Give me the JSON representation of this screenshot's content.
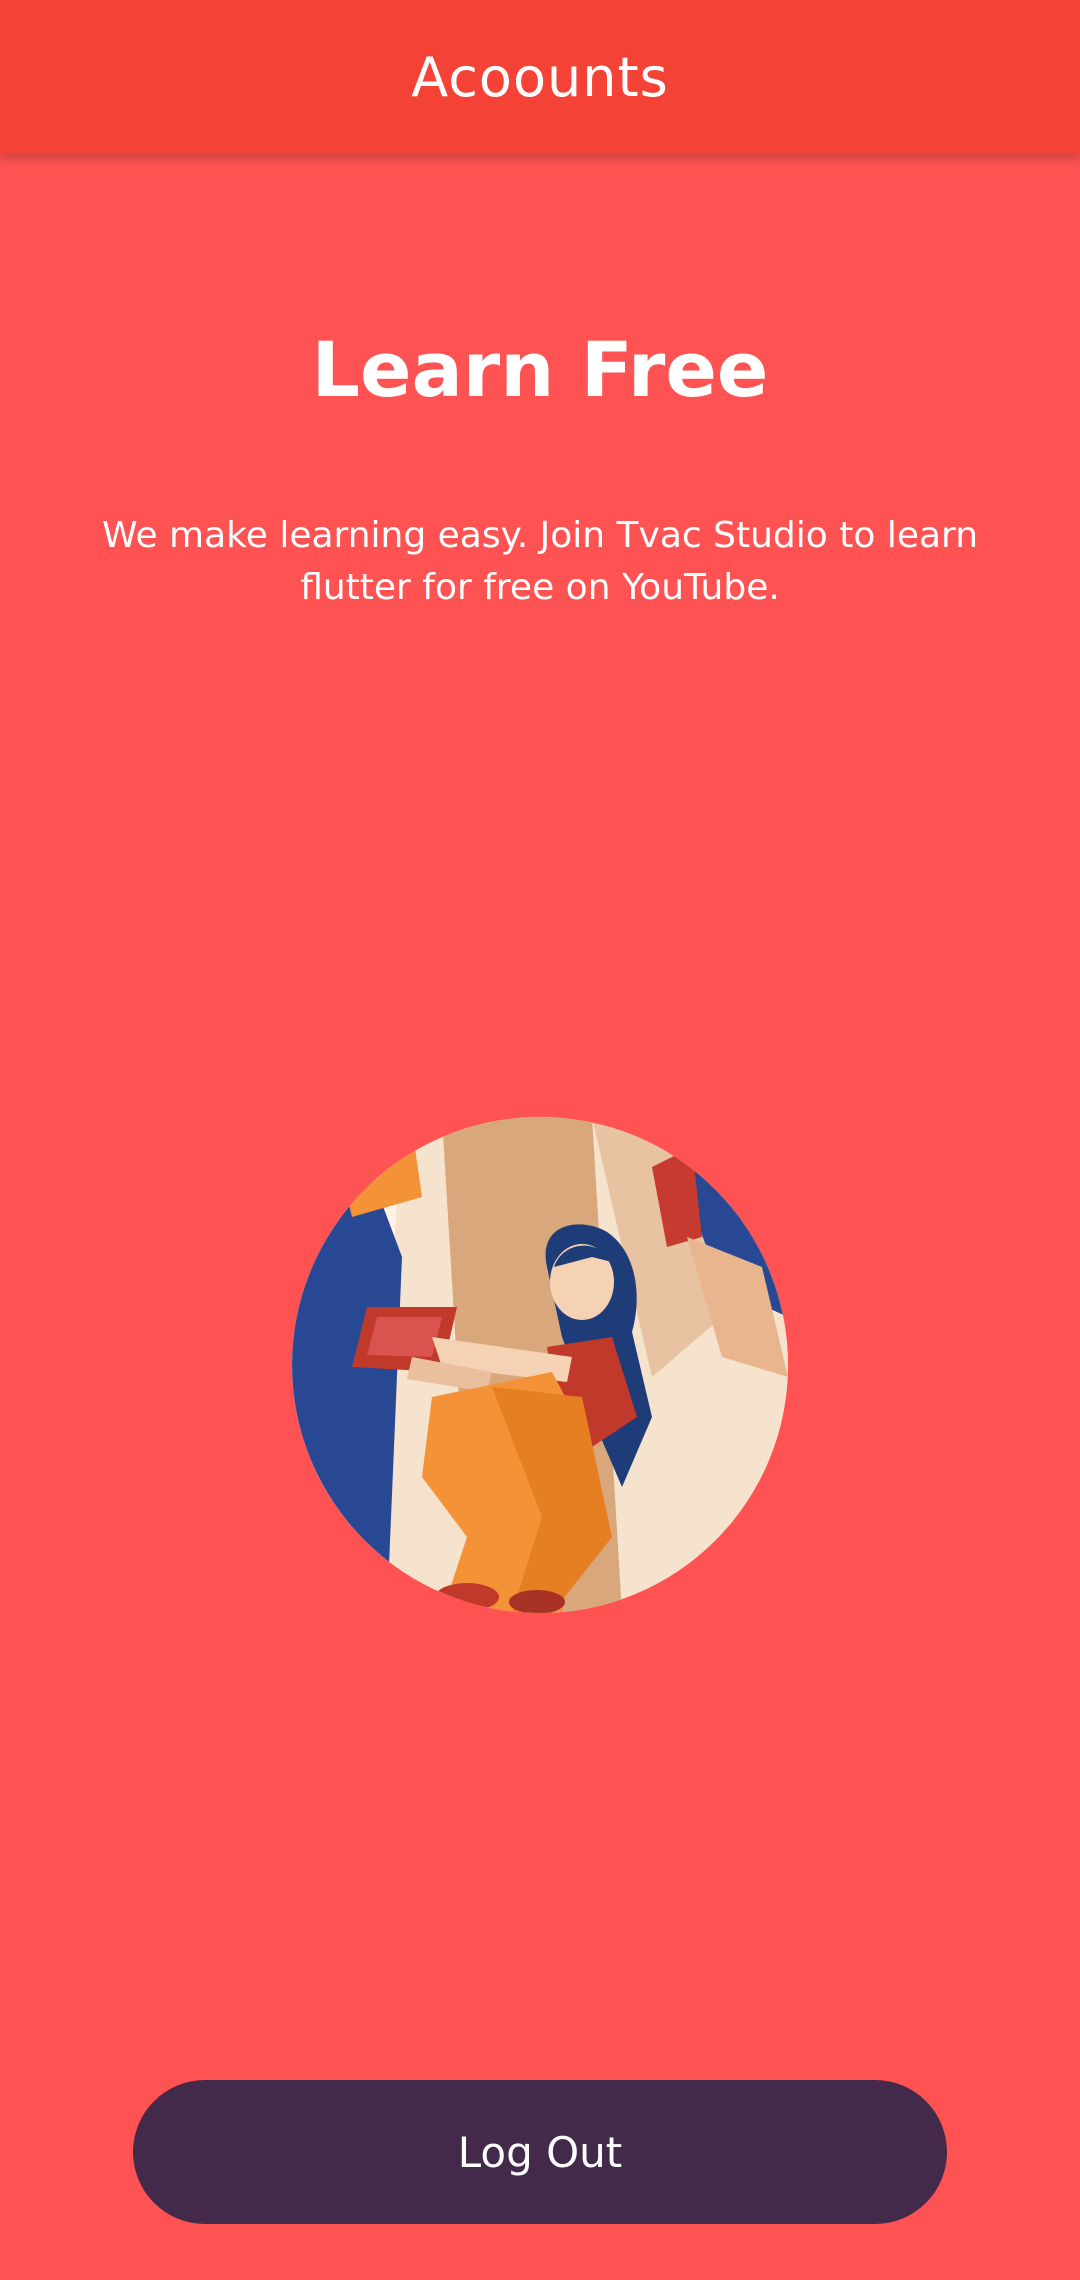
{
  "appbar": {
    "title": "Acoounts"
  },
  "main": {
    "headline": "Learn Free",
    "tagline": "We make learning easy. Join Tvac Studio to learn flutter for free on YouTube."
  },
  "illustration": {
    "icon": "learning-illustration"
  },
  "actions": {
    "logout_label": "Log Out"
  },
  "colors": {
    "background": "#FF5252",
    "appbar": "#F44336",
    "button": "#43294A",
    "text": "#FFFFFF"
  }
}
